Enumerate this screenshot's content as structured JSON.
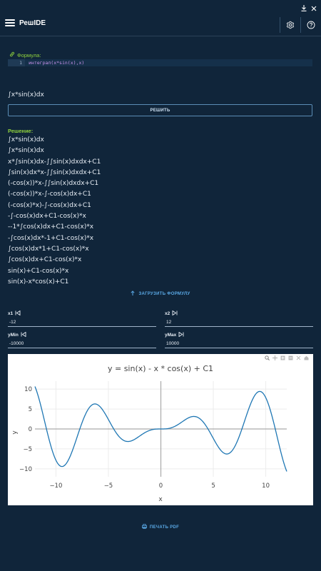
{
  "app": {
    "title": "РешIDE"
  },
  "formula": {
    "label": "Формула:",
    "line_number": "1",
    "code": "интеграл(x*sin(x),x)",
    "preview": "∫x*sin(x)dx"
  },
  "solve_label": "РЕШИТЬ",
  "solution": {
    "label": "Решение:",
    "steps": [
      "∫x*sin(x)dx",
      "∫x*sin(x)dx",
      "x*∫sin(x)dx-∫∫sin(x)dxdx+C1",
      "∫sin(x)dx*x-∫∫sin(x)dxdx+C1",
      "(-cos(x))*x-∫∫sin(x)dxdx+C1",
      "(-cos(x))*x-∫-cos(x)dx+C1",
      "(-cos(x)*x)-∫-cos(x)dx+C1",
      "-∫-cos(x)dx+C1-cos(x)*x",
      "--1*∫cos(x)dx+C1-cos(x)*x",
      "-∫cos(x)dx*-1+C1-cos(x)*x",
      "∫cos(x)dx*1+C1-cos(x)*x",
      "∫cos(x)dx+C1-cos(x)*x",
      "sin(x)+C1-cos(x)*x",
      "sin(x)-x*cos(x)+C1"
    ]
  },
  "upload_label": "ЗАГРУЗИТЬ ФОРМУЛУ",
  "ranges": {
    "x1": {
      "label": "x1",
      "value": "-12"
    },
    "x2": {
      "label": "x2",
      "value": "12"
    },
    "ymin": {
      "label": "yMin",
      "value": "-10000"
    },
    "ymax": {
      "label": "yMax",
      "value": "10000"
    }
  },
  "chart_data": {
    "type": "line",
    "title": "y = sin(x) - x * cos(x) + C1",
    "xlabel": "x",
    "ylabel": "y",
    "function": "sin(x) - x*cos(x)",
    "xlim": [
      -12,
      12
    ],
    "ylim": [
      -12,
      12
    ],
    "x_ticks": [
      -10,
      -5,
      0,
      5,
      10
    ],
    "x_tick_labels": [
      "−10",
      "−5",
      "0",
      "5",
      "10"
    ],
    "y_ticks": [
      -10,
      -5,
      0,
      5,
      10
    ],
    "y_tick_labels": [
      "−10",
      "−5",
      "0",
      "5",
      "10"
    ],
    "series": [
      {
        "x": [
          -12,
          -11,
          -10,
          -9,
          -8,
          -7,
          -6,
          -5,
          -4,
          -3,
          -2,
          -1,
          0,
          1,
          2,
          3,
          4,
          5,
          6,
          7,
          8,
          9,
          10,
          11,
          12
        ],
        "y": [
          10.67,
          -1.99,
          -8.93,
          -8.61,
          -0.17,
          5.94,
          6.04,
          0.46,
          -3.37,
          -3.11,
          -1.74,
          -0.3,
          0,
          0.3,
          1.74,
          3.11,
          3.37,
          -0.46,
          -6.04,
          -5.94,
          0.17,
          8.61,
          8.93,
          1.99,
          -10.67
        ]
      }
    ],
    "line_color": "#1f77b4",
    "grid": true
  },
  "print_label": "ПЕЧАТЬ PDF"
}
